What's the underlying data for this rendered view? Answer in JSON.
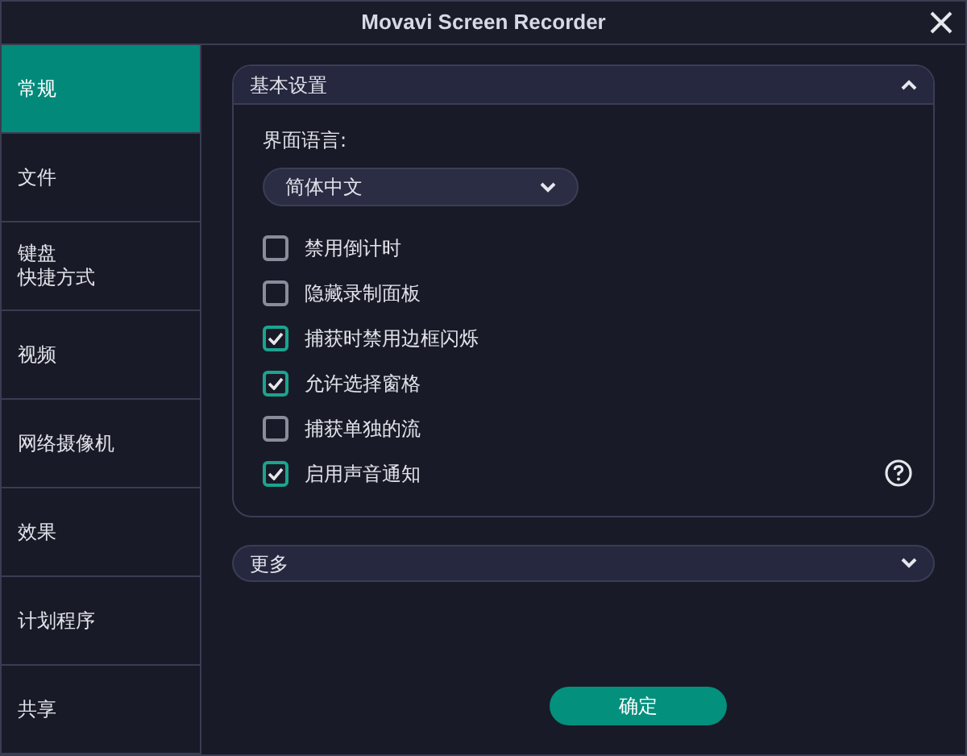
{
  "window": {
    "title": "Movavi Screen Recorder"
  },
  "sidebar": {
    "items": [
      {
        "lines": [
          "常规"
        ],
        "selected": true
      },
      {
        "lines": [
          "文件"
        ],
        "selected": false
      },
      {
        "lines": [
          "键盘",
          "快捷方式"
        ],
        "selected": false
      },
      {
        "lines": [
          "视频"
        ],
        "selected": false
      },
      {
        "lines": [
          "网络摄像机"
        ],
        "selected": false
      },
      {
        "lines": [
          "效果"
        ],
        "selected": false
      },
      {
        "lines": [
          "计划程序"
        ],
        "selected": false
      },
      {
        "lines": [
          "共享"
        ],
        "selected": false
      }
    ]
  },
  "basic_settings": {
    "title": "基本设置",
    "expanded": true,
    "language_label": "界面语言:",
    "language": "简体中文",
    "options": [
      {
        "label": "禁用倒计时",
        "checked": false
      },
      {
        "label": "隐藏录制面板",
        "checked": false
      },
      {
        "label": "捕获时禁用边框闪烁",
        "checked": true
      },
      {
        "label": "允许选择窗格",
        "checked": true
      },
      {
        "label": "捕获单独的流",
        "checked": false
      },
      {
        "label": "启用声音通知",
        "checked": true
      }
    ]
  },
  "more": {
    "title": "更多",
    "expanded": false
  },
  "ok_button": "确定"
}
